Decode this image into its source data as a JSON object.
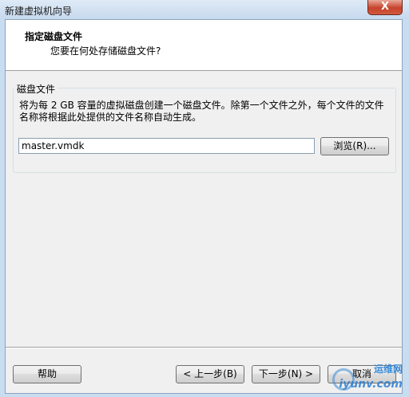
{
  "window": {
    "title": "新建虚拟机向导",
    "close_glyph": "X"
  },
  "header": {
    "title": "指定磁盘文件",
    "subtitle": "您要在何处存储磁盘文件?"
  },
  "disk_file": {
    "group_label": "磁盘文件",
    "description": "将为每 2 GB 容量的虚拟磁盘创建一个磁盘文件。除第一个文件之外，每个文件的文件名称将根据此处提供的文件名称自动生成。",
    "value": "master.vmdk",
    "browse_label": "浏览(R)..."
  },
  "footer": {
    "help_label": "帮助",
    "back_label": "< 上一步(B)",
    "next_label": "下一步(N) >",
    "cancel_label": "取消"
  },
  "watermark": {
    "top_text": "运维网",
    "bottom_text": "iyunv.com"
  }
}
